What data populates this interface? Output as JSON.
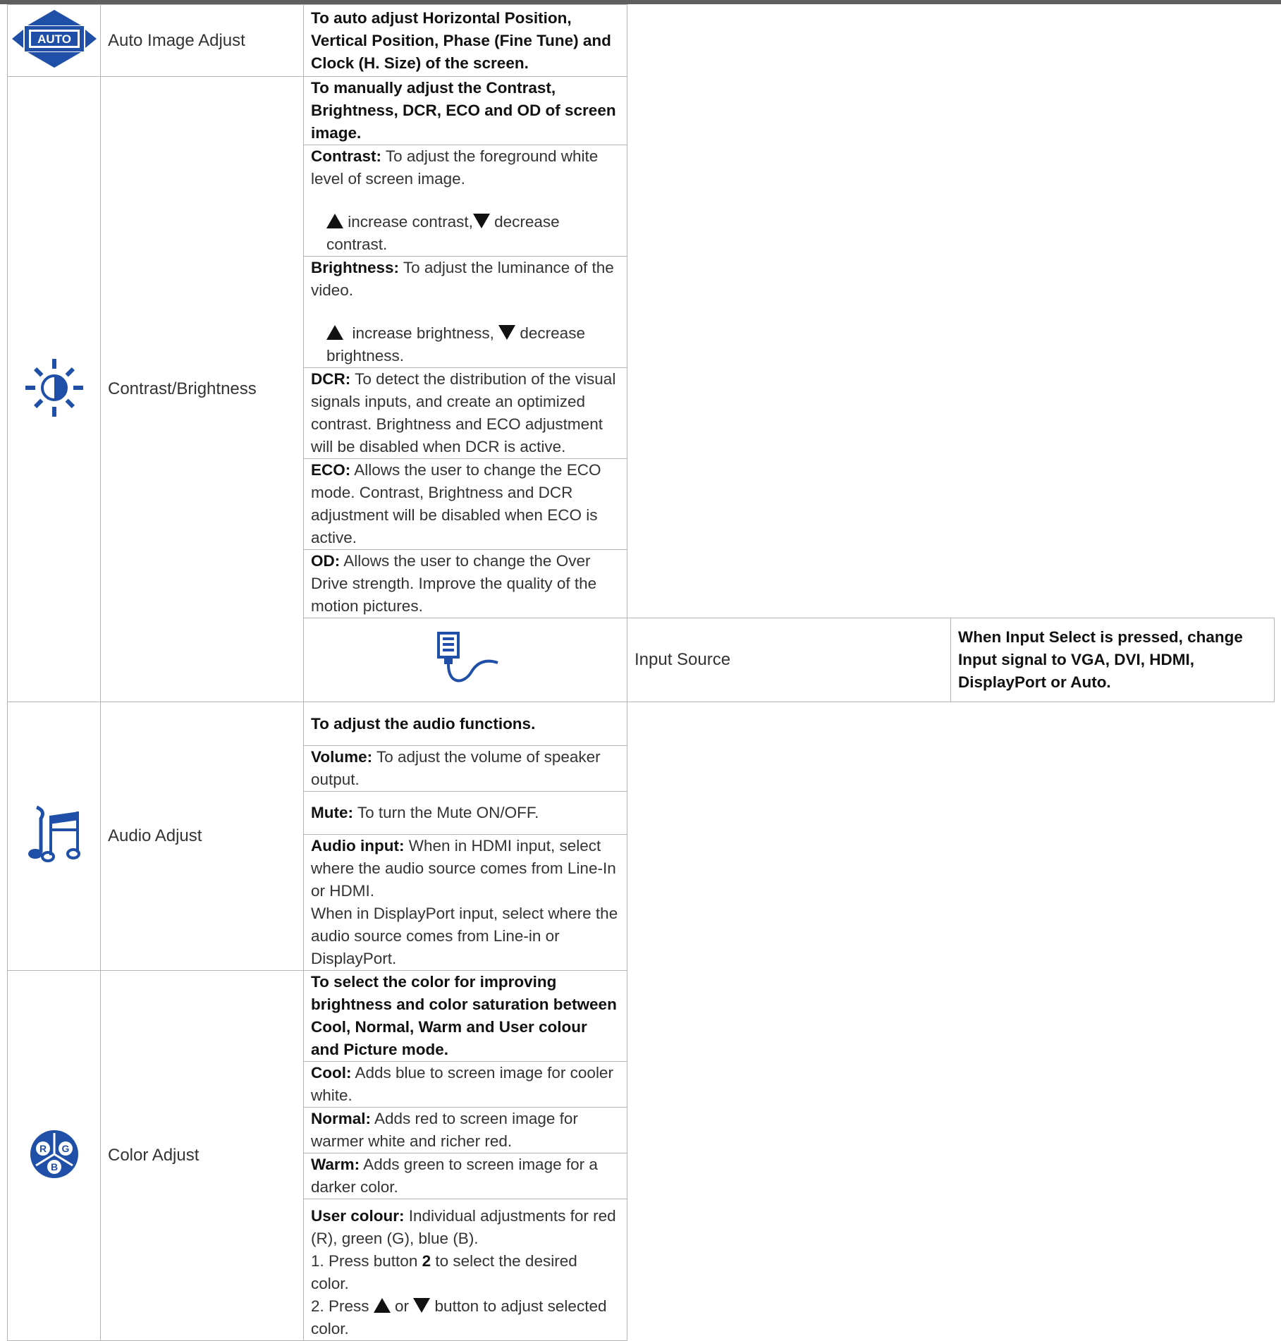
{
  "colors": {
    "icon_blue": "#1f4fa6",
    "rule": "#b4b4b4",
    "top_bar": "#5e5e5e"
  },
  "auto": {
    "name": "Auto Image Adjust",
    "icon": "auto-icon",
    "icon_text": "AUTO",
    "desc": "To auto adjust Horizontal Position, Vertical Position, Phase (Fine Tune) and Clock (H. Size) of the screen."
  },
  "contrast": {
    "name": "Contrast/Brightness",
    "icon": "brightness-icon",
    "title": "To manually adjust the Contrast, Brightness, DCR, ECO and OD of screen image.",
    "contrast_label": "Contrast:",
    "contrast_text": " To adjust the foreground white level of screen image.",
    "contrast_up": " increase contrast,",
    "contrast_down": " decrease contrast.",
    "brightness_label": "Brightness:",
    "brightness_text": " To adjust the luminance of the video.",
    "brightness_up": " increase brightness,",
    "brightness_down": " decrease brightness.",
    "dcr_label": "DCR:",
    "dcr_text": " To detect the distribution of the visual signals inputs, and create an optimized contrast. Brightness and ECO adjustment will be disabled when DCR is active.",
    "eco_label": "ECO:",
    "eco_text": " Allows the user to change the ECO mode. Contrast, Brightness and DCR adjustment will be disabled when ECO is active.",
    "od_label": "OD:",
    "od_text": " Allows the user to change the Over Drive strength. Improve the quality of the motion pictures."
  },
  "input": {
    "name": "Input Source",
    "icon": "input-source-icon",
    "desc": "When Input Select is pressed, change Input signal to VGA, DVI, HDMI, DisplayPort or Auto."
  },
  "audio": {
    "name": "Audio Adjust",
    "icon": "music-note-icon",
    "title": "To adjust the audio functions.",
    "volume_label": "Volume:",
    "volume_text": " To adjust the volume of speaker output.",
    "mute_label": "Mute:",
    "mute_text": " To turn the Mute ON/OFF.",
    "ainput_label": "Audio input:",
    "ainput_text1": " When in HDMI input, select where the audio source comes from Line-In or HDMI.",
    "ainput_text2": "When in DisplayPort input, select where the audio source comes from Line-in or DisplayPort."
  },
  "color": {
    "name": "Color Adjust",
    "icon": "rgb-icon",
    "icon_r": "R",
    "icon_g": "G",
    "icon_b": "B",
    "title": "To select the color for improving brightness and color saturation between Cool, Normal, Warm and User colour and Picture mode.",
    "cool_label": "Cool:",
    "cool_text": " Adds blue to screen image for cooler white.",
    "normal_label": "Normal:",
    "normal_text": " Adds red to screen image for warmer white and richer red.",
    "warm_label": "Warm:",
    "warm_text": " Adds green to screen image for a darker color.",
    "user_label": "User colour:",
    "user_text": " Individual adjustments for red (R), green (G), blue (B).",
    "step1_a": "1. Press button ",
    "step1_b": "2",
    "step1_c": " to select the desired color.",
    "step2_a": "2. Press ",
    "step2_b": " or ",
    "step2_c": " button to adjust selected color."
  }
}
